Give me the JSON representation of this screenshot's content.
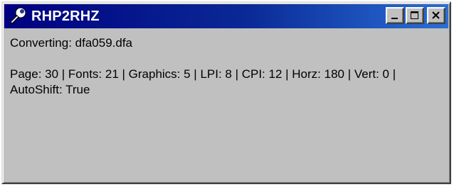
{
  "window": {
    "title": "RHP2RHZ",
    "app_icon": "wrench-icon",
    "buttons": [
      "minimize-icon",
      "maximize-icon",
      "close-icon"
    ],
    "colors": {
      "titlebar_start": "#000080",
      "titlebar_end": "#2a6fd6",
      "face": "#c0c0c0"
    }
  },
  "status": {
    "converting": "Converting: dfa059.dfa",
    "details": "Page: 30 | Fonts: 21 | Graphics: 5 | LPI: 8 | CPI: 12 | Horz: 180 | Vert: 0 | AutoShift: True"
  }
}
